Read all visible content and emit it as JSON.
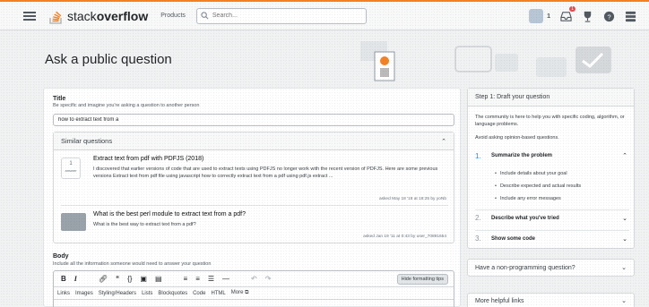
{
  "topbar": {
    "logo_text_light": "stack",
    "logo_text_bold": "overflow",
    "products_label": "Products",
    "search_placeholder": "Search...",
    "reputation": "1",
    "inbox_badge": "1"
  },
  "page": {
    "title": "Ask a public question"
  },
  "title_field": {
    "label": "Title",
    "description": "Be specific and imagine you're asking a question to another person",
    "value": "how to extract text from a "
  },
  "similar": {
    "heading": "Similar questions",
    "items": [
      {
        "votes": "1",
        "votes_label": "answer",
        "title": "Extract text from pdf with PDFJS (2018)",
        "excerpt": "I discovered that earlier versions of code that are used to extract texts using PDFJS no longer work with the recent version of PDFJS. Here are some previous versions Extract text from pdf file using javascript how to correctly extract text from a pdf using pdf.js extract ...",
        "meta": "asked May 18 '18 at 18:25 by yoNb"
      },
      {
        "title": "What is the best perl module to extract text from a pdf?",
        "excerpt": "What is the best way to extract text from a pdf?",
        "meta": "asked Jan 19 '11 at 0:43 by user_70891654"
      }
    ]
  },
  "body_field": {
    "label": "Body",
    "description": "Include all the information someone would need to answer your question",
    "hide_tips": "Hide formatting tips",
    "tip_tabs": [
      "Links",
      "Images",
      "Styling/Headers",
      "Lists",
      "Blockquotes",
      "Code",
      "HTML",
      "More ⧉"
    ]
  },
  "sidebar": {
    "heading": "Step 1: Draft your question",
    "intro": "The community is here to help you with specific coding, algorithm, or language problems.",
    "avoid": "Avoid asking opinion-based questions.",
    "steps": [
      {
        "num": "1.",
        "label": "Summarize the problem"
      },
      {
        "num": "2.",
        "label": "Describe what you've tried"
      },
      {
        "num": "3.",
        "label": "Show some code"
      }
    ],
    "bullets": [
      "Include details about your goal",
      "Describe expected and actual results",
      "Include any error messages"
    ],
    "box1": "Have a non-programming question?",
    "box2": "More helpful links"
  },
  "colors": {
    "accent": "#f48225",
    "link": "#0a95ff",
    "text": "#232629"
  },
  "icons": [
    "hamburger-icon",
    "stackoverflow-logo-icon",
    "search-icon",
    "inbox-icon",
    "achievements-icon",
    "help-icon",
    "stackexchange-icon",
    "chevron-up-icon",
    "chevron-down-icon",
    "bold-icon",
    "italic-icon",
    "link-icon",
    "quote-icon",
    "code-icon",
    "image-icon",
    "snippet-icon",
    "numbered-list-icon",
    "bulleted-list-icon",
    "heading-icon",
    "horizontal-rule-icon",
    "undo-icon",
    "redo-icon"
  ]
}
